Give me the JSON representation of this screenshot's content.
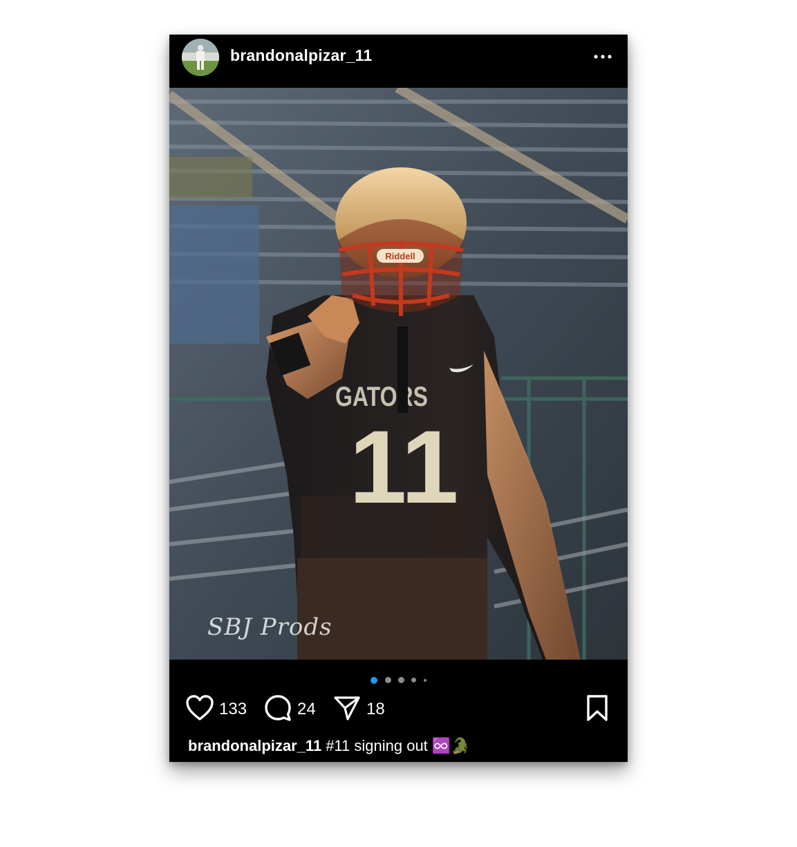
{
  "post": {
    "username": "brandonalpizar_11",
    "photo_watermark": "SBJ Prods",
    "photo_jersey_text": "GATORS",
    "photo_jersey_number": "11",
    "photo_helmet_brand": "Riddell",
    "carousel": {
      "total": 5,
      "active": 1,
      "active_color": "#1d9bf0"
    },
    "likes": "133",
    "comments": "24",
    "shares": "18",
    "caption_username": "brandonalpizar_11",
    "caption_text": "#11 signing out ♾️🐊"
  },
  "icons": {
    "more": "more-options-icon",
    "like": "heart-icon",
    "comment": "comment-icon",
    "share": "paper-plane-icon",
    "save": "bookmark-icon"
  }
}
